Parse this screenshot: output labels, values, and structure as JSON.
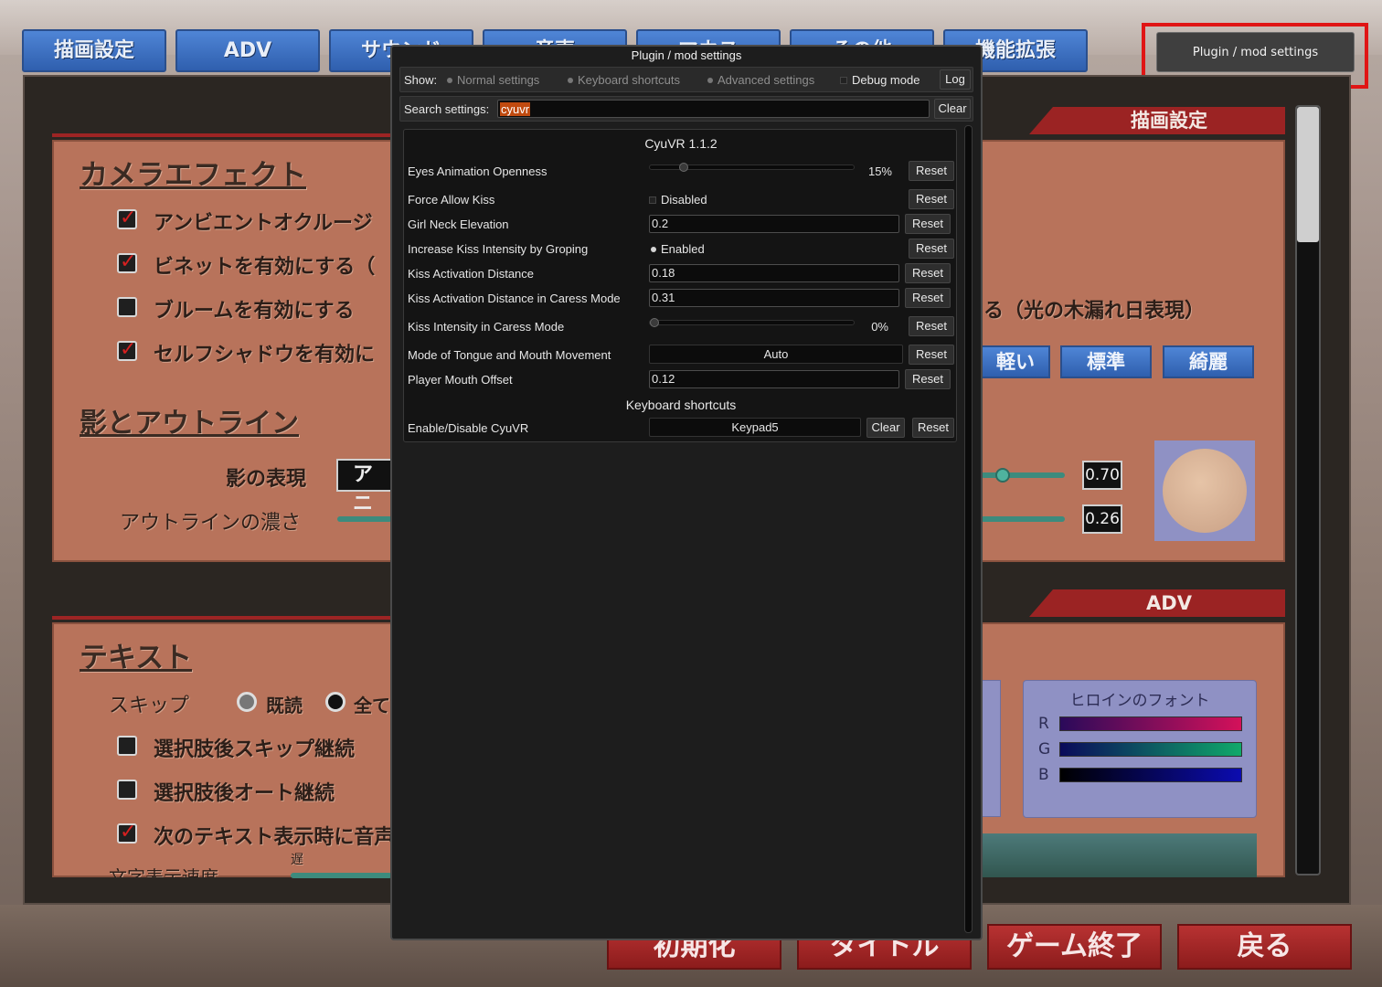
{
  "game": {
    "top_tabs": [
      "描画設定",
      "ADV",
      "サウンド",
      "音声",
      "マウス",
      "その他",
      "機能拡張"
    ],
    "mod_button_label": "Plugin / mod settings",
    "sections": {
      "camera_effect_title": "カメラエフェクト",
      "ambient_occlusion": "アンビエントオクルージ",
      "vignette": "ビネットを有効にする（",
      "bloom": "ブルームを有効にする",
      "self_shadow": "セルフシャドウを有効に",
      "komorebi_suffix": "る（光の木漏れ日表現）",
      "shadow_outline_title": "影とアウトライン",
      "shadow_expression": "影の表現",
      "shadow_expression_value": "アニ",
      "outline_density": "アウトラインの濃さ",
      "quality_light": "軽い",
      "quality_standard": "標準",
      "quality_pretty": "綺麗",
      "value_1": "0.70",
      "value_2": "0.26",
      "ribbon_render": "描画設定",
      "ribbon_adv": "ADV",
      "text_title": "テキスト",
      "skip_label": "スキップ",
      "skip_read": "既読",
      "skip_all": "全て",
      "skip_after_choice": "選択肢後スキップ継続",
      "auto_after_choice": "選択肢後オート継続",
      "voice_next_text": "次のテキスト表示時に音声",
      "text_speed": "文字表示速度",
      "slow": "遅",
      "heroine_font": "ヒロインのフォント",
      "r": "R",
      "g": "G",
      "b": "B"
    },
    "bottom_buttons": [
      "初期化",
      "タイトル",
      "ゲーム終了",
      "戻る"
    ]
  },
  "dialog": {
    "title": "Plugin / mod settings",
    "show_label": "Show:",
    "filters": [
      {
        "label": "Normal settings",
        "checked": false
      },
      {
        "label": "Keyboard shortcuts",
        "checked": false
      },
      {
        "label": "Advanced settings",
        "checked": false
      }
    ],
    "debug_mode_label": "Debug mode",
    "log_button": "Log",
    "search_label": "Search settings:",
    "search_value": "cyuvr",
    "clear_button": "Clear",
    "plugin_header": "CyuVR 1.1.2",
    "reset_label": "Reset",
    "settings": [
      {
        "name": "Eyes Animation Openness",
        "type": "slider",
        "value": "15%",
        "level": 0.15
      },
      {
        "name": "Force Allow Kiss",
        "type": "toggle",
        "value": "Disabled"
      },
      {
        "name": "Girl Neck Elevation",
        "type": "text",
        "value": "0.2"
      },
      {
        "name": "Increase Kiss Intensity by Groping",
        "type": "toggle",
        "value": "Enabled"
      },
      {
        "name": "Kiss Activation Distance",
        "type": "text",
        "value": "0.18"
      },
      {
        "name": "Kiss Activation Distance in Caress Mode",
        "type": "text",
        "value": "0.31"
      },
      {
        "name": "Kiss Intensity in Caress Mode",
        "type": "slider",
        "value": "0%",
        "level": 0.0
      },
      {
        "name": "Mode of Tongue and Mouth Movement",
        "type": "dropdown",
        "value": "Auto"
      },
      {
        "name": "Player Mouth Offset",
        "type": "text",
        "value": "0.12"
      }
    ],
    "keyboard_header": "Keyboard shortcuts",
    "shortcut": {
      "name": "Enable/Disable CyuVR",
      "value": "Keypad5",
      "clear": "Clear"
    }
  }
}
